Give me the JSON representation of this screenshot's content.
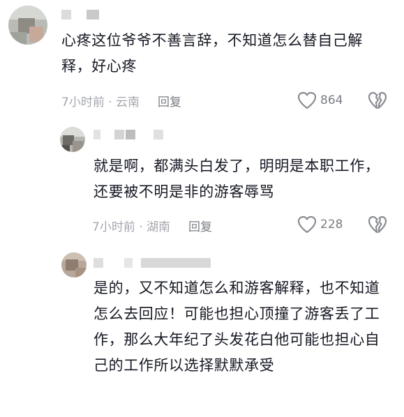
{
  "comments": [
    {
      "text": "心疼这位爷爷不善言辞，不知道怎么替自己解释，好心疼",
      "time_location": "7小时前 · 云南",
      "reply_label": "回复",
      "like_count": "864"
    },
    {
      "text": "就是啊，都满头白发了，明明是本职工作，还要被不明是非的游客辱骂",
      "time_location": "7小时前 · 湖南",
      "reply_label": "回复",
      "like_count": "228"
    },
    {
      "text": "是的，又不知道怎么和游客解释，也不知道怎么去回应！可能也担心顶撞了游客丢了工作，那么大年纪了头发花白他可能也担心自己的工作所以选择默默承受"
    }
  ],
  "colors": {
    "text": "#161823",
    "meta": "#a4a6ad",
    "icon": "#8a8c93"
  }
}
